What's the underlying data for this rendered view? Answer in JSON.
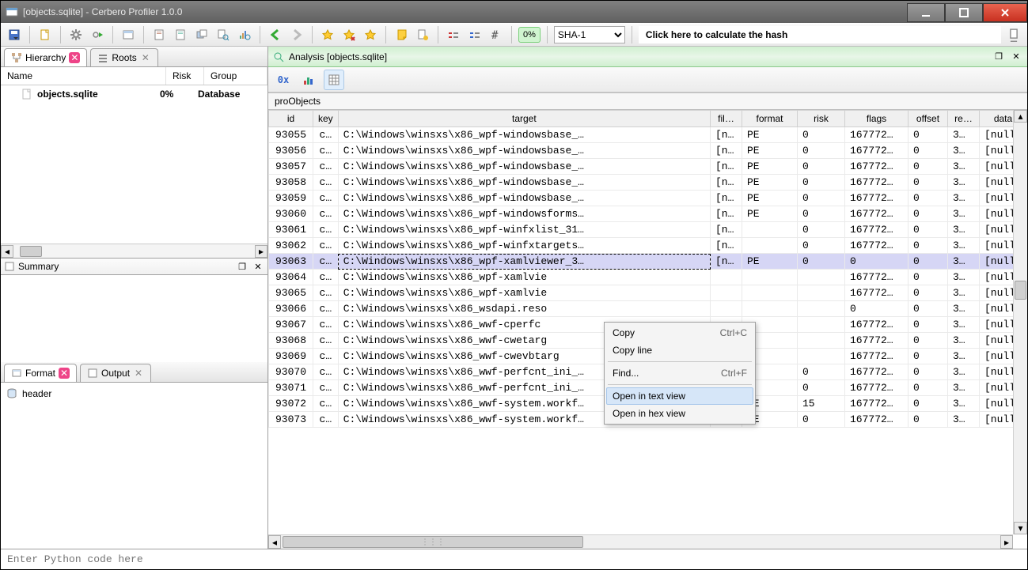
{
  "window": {
    "title": "[objects.sqlite] - Cerbero Profiler 1.0.0"
  },
  "toolbar": {
    "percent": "0%",
    "hash_algo": "SHA-1",
    "hash_hint": "Click here to calculate the hash"
  },
  "left_tabs": {
    "hierarchy": "Hierarchy",
    "roots": "Roots"
  },
  "hierarchy": {
    "columns": {
      "name": "Name",
      "risk": "Risk",
      "group": "Group"
    },
    "rows": [
      {
        "name": "objects.sqlite",
        "risk": "0%",
        "group": "Database"
      }
    ]
  },
  "summary": {
    "title": "Summary"
  },
  "format_tabs": {
    "format": "Format",
    "output": "Output"
  },
  "format": {
    "header": "header"
  },
  "analysis": {
    "title": "Analysis [objects.sqlite]"
  },
  "view_tb": {
    "hex": "0x"
  },
  "table": {
    "name": "proObjects",
    "columns": {
      "id": "id",
      "key": "key",
      "target": "target",
      "fil": "fil…",
      "format": "format",
      "risk": "risk",
      "flags": "flags",
      "offset": "offset",
      "re": "re…",
      "data": "data"
    },
    "selected_index": 8,
    "rows": [
      {
        "id": "93055",
        "key": "c…",
        "target": "C:\\Windows\\winsxs\\x86_wpf-windowsbase_…",
        "fil": "[n…",
        "format": "PE",
        "risk": "0",
        "flags": "167772…",
        "offset": "0",
        "re": "3…",
        "data": "[null]"
      },
      {
        "id": "93056",
        "key": "c…",
        "target": "C:\\Windows\\winsxs\\x86_wpf-windowsbase_…",
        "fil": "[n…",
        "format": "PE",
        "risk": "0",
        "flags": "167772…",
        "offset": "0",
        "re": "3…",
        "data": "[null]"
      },
      {
        "id": "93057",
        "key": "c…",
        "target": "C:\\Windows\\winsxs\\x86_wpf-windowsbase_…",
        "fil": "[n…",
        "format": "PE",
        "risk": "0",
        "flags": "167772…",
        "offset": "0",
        "re": "3…",
        "data": "[null]"
      },
      {
        "id": "93058",
        "key": "c…",
        "target": "C:\\Windows\\winsxs\\x86_wpf-windowsbase_…",
        "fil": "[n…",
        "format": "PE",
        "risk": "0",
        "flags": "167772…",
        "offset": "0",
        "re": "3…",
        "data": "[null]"
      },
      {
        "id": "93059",
        "key": "c…",
        "target": "C:\\Windows\\winsxs\\x86_wpf-windowsbase_…",
        "fil": "[n…",
        "format": "PE",
        "risk": "0",
        "flags": "167772…",
        "offset": "0",
        "re": "3…",
        "data": "[null]"
      },
      {
        "id": "93060",
        "key": "c…",
        "target": "C:\\Windows\\winsxs\\x86_wpf-windowsforms…",
        "fil": "[n…",
        "format": "PE",
        "risk": "0",
        "flags": "167772…",
        "offset": "0",
        "re": "3…",
        "data": "[null]"
      },
      {
        "id": "93061",
        "key": "c…",
        "target": "C:\\Windows\\winsxs\\x86_wpf-winfxlist_31…",
        "fil": "[n…",
        "format": "",
        "risk": "0",
        "flags": "167772…",
        "offset": "0",
        "re": "3…",
        "data": "[null]"
      },
      {
        "id": "93062",
        "key": "c…",
        "target": "C:\\Windows\\winsxs\\x86_wpf-winfxtargets…",
        "fil": "[n…",
        "format": "",
        "risk": "0",
        "flags": "167772…",
        "offset": "0",
        "re": "3…",
        "data": "[null]"
      },
      {
        "id": "93063",
        "key": "c…",
        "target": "C:\\Windows\\winsxs\\x86_wpf-xamlviewer_3…",
        "fil": "[n…",
        "format": "PE",
        "risk": "0",
        "flags": "0",
        "offset": "0",
        "re": "3…",
        "data": "[null]"
      },
      {
        "id": "93064",
        "key": "c…",
        "target": "C:\\Windows\\winsxs\\x86_wpf-xamlvie",
        "fil": "",
        "format": "",
        "risk": "",
        "flags": "167772…",
        "offset": "0",
        "re": "3…",
        "data": "[null]"
      },
      {
        "id": "93065",
        "key": "c…",
        "target": "C:\\Windows\\winsxs\\x86_wpf-xamlvie",
        "fil": "",
        "format": "",
        "risk": "",
        "flags": "167772…",
        "offset": "0",
        "re": "3…",
        "data": "[null]"
      },
      {
        "id": "93066",
        "key": "c…",
        "target": "C:\\Windows\\winsxs\\x86_wsdapi.reso",
        "fil": "",
        "format": "",
        "risk": "",
        "flags": "0",
        "offset": "0",
        "re": "3…",
        "data": "[null]"
      },
      {
        "id": "93067",
        "key": "c…",
        "target": "C:\\Windows\\winsxs\\x86_wwf-cperfc",
        "fil": "",
        "format": "",
        "risk": "",
        "flags": "167772…",
        "offset": "0",
        "re": "3…",
        "data": "[null]"
      },
      {
        "id": "93068",
        "key": "c…",
        "target": "C:\\Windows\\winsxs\\x86_wwf-cwetarg",
        "fil": "",
        "format": "",
        "risk": "",
        "flags": "167772…",
        "offset": "0",
        "re": "3…",
        "data": "[null]"
      },
      {
        "id": "93069",
        "key": "c…",
        "target": "C:\\Windows\\winsxs\\x86_wwf-cwevbtarg",
        "fil": "",
        "format": "",
        "risk": "",
        "flags": "167772…",
        "offset": "0",
        "re": "3…",
        "data": "[null]"
      },
      {
        "id": "93070",
        "key": "c…",
        "target": "C:\\Windows\\winsxs\\x86_wwf-perfcnt_ini_…",
        "fil": "[n…",
        "format": "",
        "risk": "0",
        "flags": "167772…",
        "offset": "0",
        "re": "3…",
        "data": "[null]"
      },
      {
        "id": "93071",
        "key": "c…",
        "target": "C:\\Windows\\winsxs\\x86_wwf-perfcnt_ini_…",
        "fil": "[n…",
        "format": "",
        "risk": "0",
        "flags": "167772…",
        "offset": "0",
        "re": "3…",
        "data": "[null]"
      },
      {
        "id": "93072",
        "key": "c…",
        "target": "C:\\Windows\\winsxs\\x86_wwf-system.workf…",
        "fil": "[n…",
        "format": "PE",
        "risk": "15",
        "flags": "167772…",
        "offset": "0",
        "re": "3…",
        "data": "[null]"
      },
      {
        "id": "93073",
        "key": "c…",
        "target": "C:\\Windows\\winsxs\\x86_wwf-system.workf…",
        "fil": "[n…",
        "format": "PE",
        "risk": "0",
        "flags": "167772…",
        "offset": "0",
        "re": "3…",
        "data": "[null]"
      }
    ]
  },
  "context_menu": {
    "copy": "Copy",
    "copy_sc": "Ctrl+C",
    "copy_line": "Copy line",
    "find": "Find...",
    "find_sc": "Ctrl+F",
    "open_text": "Open in text view",
    "open_hex": "Open in hex view"
  },
  "statusbar": {
    "placeholder": "Enter Python code here"
  }
}
